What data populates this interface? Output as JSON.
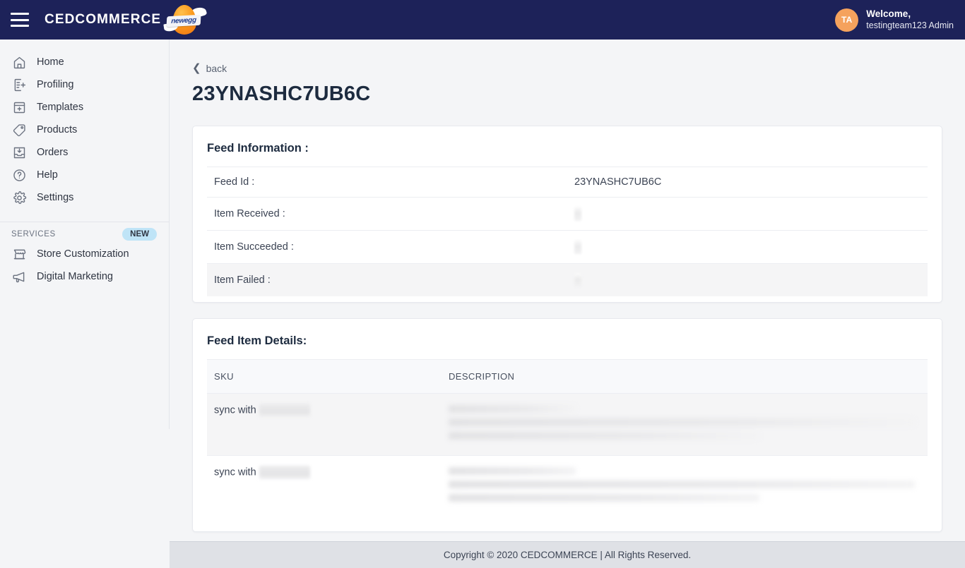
{
  "navbar": {
    "menu_icon": "hamburger-icon",
    "brand_text": "CEDCOMMERCE",
    "brand_logo": "newegg-logo",
    "brand_logo_text": "newegg",
    "user": {
      "initials": "TA",
      "welcome": "Welcome,",
      "name": "testingteam123 Admin"
    },
    "bg_color": "#1d2259"
  },
  "sidebar": {
    "items": [
      {
        "label": "Home",
        "icon": "home-icon"
      },
      {
        "label": "Profiling",
        "icon": "document-plus-icon"
      },
      {
        "label": "Templates",
        "icon": "window-plus-icon"
      },
      {
        "label": "Products",
        "icon": "tag-icon"
      },
      {
        "label": "Orders",
        "icon": "inbox-download-icon"
      },
      {
        "label": "Help",
        "icon": "question-circle-icon"
      },
      {
        "label": "Settings",
        "icon": "gear-icon"
      }
    ],
    "services": {
      "title": "SERVICES",
      "badge": "NEW",
      "badge_color": "#bfe4f7",
      "items": [
        {
          "label": "Store Customization",
          "icon": "storefront-icon"
        },
        {
          "label": "Digital Marketing",
          "icon": "megaphone-icon"
        }
      ]
    }
  },
  "main": {
    "back_label": "back",
    "back_icon": "chevron-left-icon",
    "page_title": "23YNASHC7UB6C",
    "feed_information": {
      "title": "Feed Information :",
      "rows": [
        {
          "label": "Feed Id :",
          "value": "23YNASHC7UB6C",
          "redacted": false
        },
        {
          "label": "Item Received :",
          "value": "",
          "redacted": true
        },
        {
          "label": "Item Succeeded :",
          "value": "",
          "redacted": true
        },
        {
          "label": "Item Failed :",
          "value": "",
          "redacted": true
        }
      ]
    },
    "feed_item_details": {
      "title": "Feed Item Details:",
      "columns": [
        "SKU",
        "DESCRIPTION"
      ],
      "rows": [
        {
          "sku_prefix": "sync with",
          "sku_redacted": true,
          "description_redacted": true
        },
        {
          "sku_prefix": "sync with",
          "sku_redacted": true,
          "description_redacted": true
        }
      ]
    }
  },
  "footer": {
    "text": "Copyright © 2020 CEDCOMMERCE | All Rights Reserved."
  }
}
